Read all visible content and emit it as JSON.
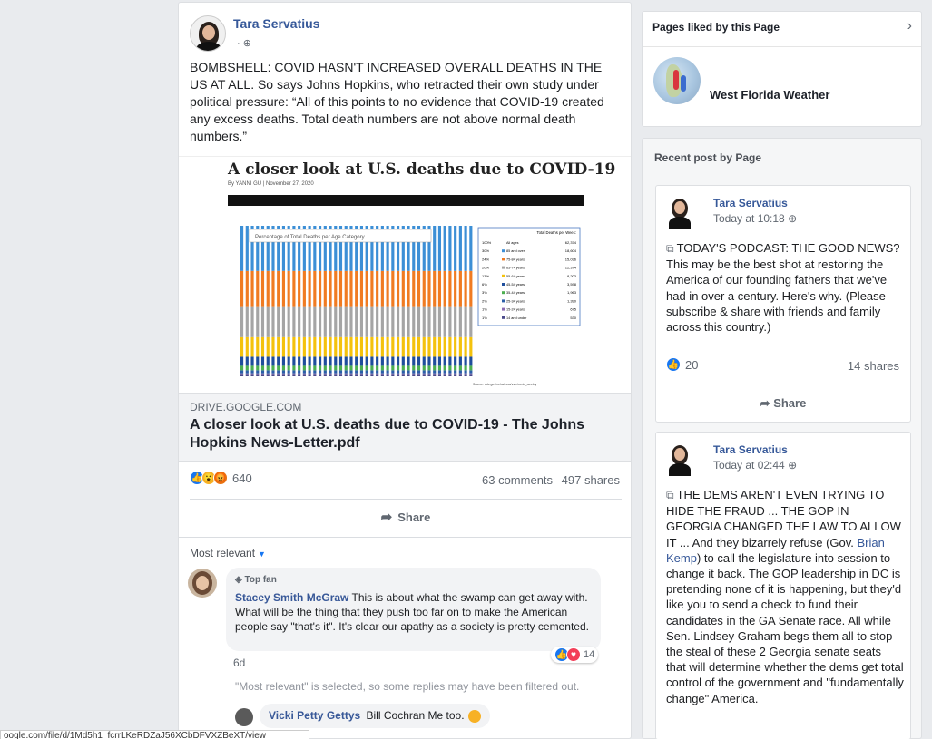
{
  "post": {
    "author": "Tara Servatius",
    "text": "BOMBSHELL: COVID HASN'T INCREASED OVERALL DEATHS IN THE US AT ALL. So says Johns Hopkins, who retracted their own study under political pressure: “All of this points to no evidence that COVID-19 created any excess deaths. Total death numbers are not above normal death numbers.”",
    "image": {
      "title": "A closer look at U.S. deaths due to COVID-19",
      "byline": "By YANNI GU | November 27, 2020",
      "chart_inner_title": "Percentage of Total Deaths per Age Category",
      "legend_title": "Total Deaths per Week:",
      "legend_rows": [
        {
          "pct": "100%",
          "label": "All ages",
          "value": "62,374"
        },
        {
          "pct": "30%",
          "label": "85 and over",
          "value": "18,604"
        },
        {
          "pct": "24%",
          "label": "75-84 years",
          "value": "15,036"
        },
        {
          "pct": "20%",
          "label": "65-74 years",
          "value": "12,374"
        },
        {
          "pct": "13%",
          "label": "55-64 years",
          "value": "8,203"
        },
        {
          "pct": "6%",
          "label": "45-54 years",
          "value": "3,598"
        },
        {
          "pct": "3%",
          "label": "35-44 years",
          "value": "1,963"
        },
        {
          "pct": "2%",
          "label": "25-34 years",
          "value": "1,390"
        },
        {
          "pct": "1%",
          "label": "15-24 years",
          "value": "675"
        },
        {
          "pct": "1%",
          "label": "14 and under",
          "value": "530"
        }
      ],
      "source": "Source: cdc.gov/nchs/nvss/vsrr/covid_weekly"
    },
    "link": {
      "domain": "DRIVE.GOOGLE.COM",
      "title": "A closer look at U.S. deaths due to COVID-19 - The Johns Hopkins News-Letter.pdf"
    },
    "reaction_count": "640",
    "comments": "63 comments",
    "shares": "497 shares",
    "share_label": "Share",
    "sort_label": "Most relevant",
    "comment": {
      "badge": "Top fan",
      "name": "Stacey Smith McGraw",
      "text": "This is about what the swamp can get away with. What will be the thing that they push too far on to make the American people say \"that's it\". It's clear our apathy as a society is pretty cemented.",
      "reactions": "14",
      "time": "6d"
    },
    "filter_note": "\"Most relevant\" is selected, so some replies may have been filtered out.",
    "reply": {
      "name": "Vicki Petty Gettys",
      "text": "Bill Cochran Me too."
    }
  },
  "status_url": "oogle.com/file/d/1Md5h1_fcrrLKeRDZaJ56XCbDFVXZBeXT/view",
  "sidebar": {
    "liked_title": "Pages liked by this Page",
    "liked_page": "West Florida Weather",
    "recent_title": "Recent post by Page",
    "posts": [
      {
        "author": "Tara Servatius",
        "time": "Today at 10:18",
        "text": "TODAY'S PODCAST: THE GOOD NEWS? This may be the best shot at restoring the America of our founding fathers that we've had in over a century. Here's why. (Please subscribe & share with friends and family across this country.)",
        "likes": "20",
        "shares": "14 shares",
        "share_label": "Share"
      },
      {
        "author": "Tara Servatius",
        "time": "Today at 02:44",
        "text_before": "THE DEMS AREN'T EVEN TRYING TO HIDE THE FRAUD ... THE GOP IN GEORGIA CHANGED THE LAW TO ALLOW IT ... And they bizarrely refuse (Gov. ",
        "mention": "Brian Kemp",
        "text_after": ") to call the legislature into session to change it back. The GOP leadership in DC is pretending none of it is happening, but they'd like you to send a check to fund their candidates in the GA Senate race. All while Sen. Lindsey Graham begs them all to stop the steal of these 2 Georgia senate seats that will determine whether the dems get total control of the government and \"fundamentally change\" America."
      }
    ]
  },
  "chart_data": {
    "type": "bar",
    "title": "Percentage of Total Deaths per Age Category",
    "x_count": 45,
    "series": [
      {
        "name": "14 and under",
        "color": "#4a4a8a",
        "values": [
          1
        ]
      },
      {
        "name": "15-24 years",
        "color": "#8c6bb1",
        "values": [
          1
        ]
      },
      {
        "name": "25-34 years",
        "color": "#2c5fa8",
        "values": [
          2
        ]
      },
      {
        "name": "35-44 years",
        "color": "#4caf50",
        "values": [
          3
        ]
      },
      {
        "name": "45-54 years",
        "color": "#1f4e9c",
        "values": [
          6
        ]
      },
      {
        "name": "55-64 years",
        "color": "#f4c20d",
        "values": [
          13
        ]
      },
      {
        "name": "65-74 years",
        "color": "#a5a5a5",
        "values": [
          20
        ]
      },
      {
        "name": "75-84 years",
        "color": "#f07b22",
        "values": [
          24
        ]
      },
      {
        "name": "85 and over",
        "color": "#3c8fd6",
        "values": [
          30
        ]
      }
    ],
    "ylim": [
      0,
      100
    ]
  }
}
